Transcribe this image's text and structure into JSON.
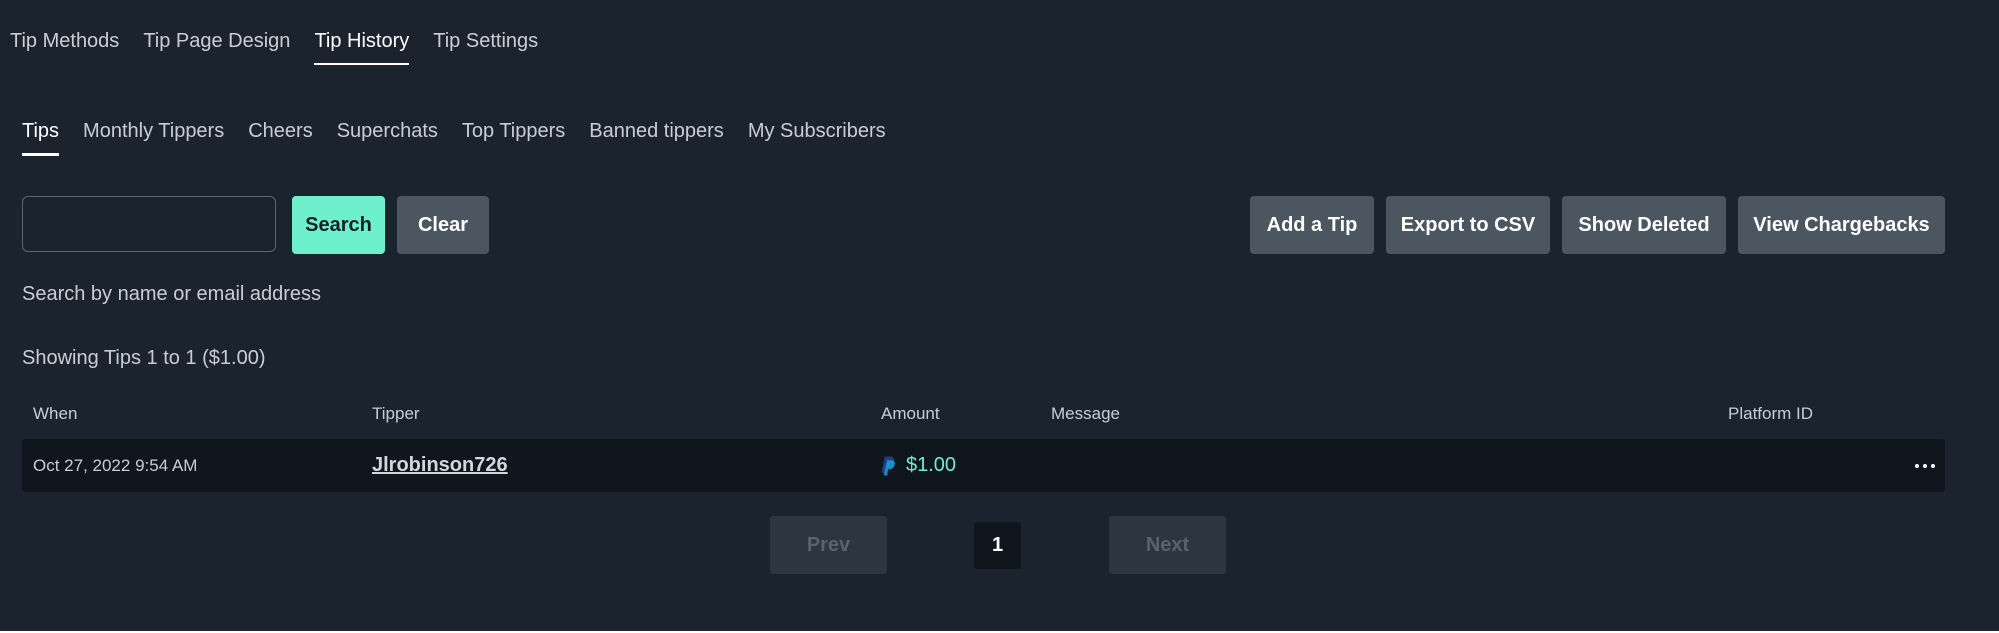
{
  "top_tabs": [
    {
      "label": "Tip Methods"
    },
    {
      "label": "Tip Page Design"
    },
    {
      "label": "Tip History",
      "active": true
    },
    {
      "label": "Tip Settings"
    }
  ],
  "sub_tabs": [
    {
      "label": "Tips",
      "active": true
    },
    {
      "label": "Monthly Tippers"
    },
    {
      "label": "Cheers"
    },
    {
      "label": "Superchats"
    },
    {
      "label": "Top Tippers"
    },
    {
      "label": "Banned tippers"
    },
    {
      "label": "My Subscribers"
    }
  ],
  "toolbar": {
    "search_value": "",
    "search_label": "Search",
    "clear_label": "Clear",
    "add_label": "Add a Tip",
    "export_label": "Export to CSV",
    "deleted_label": "Show Deleted",
    "chargebacks_label": "View Chargebacks"
  },
  "hint": "Search by name or email address",
  "showing": "Showing Tips 1 to 1 ($1.00)",
  "table": {
    "headers": {
      "when": "When",
      "tipper": "Tipper",
      "amount": "Amount",
      "message": "Message",
      "platform_id": "Platform ID"
    },
    "rows": [
      {
        "when": "Oct 27, 2022 9:54 AM",
        "tipper": "Jlrobinson726",
        "amount": "$1.00",
        "method_icon": "paypal-icon",
        "message": "",
        "platform_id": ""
      }
    ]
  },
  "pagination": {
    "prev_label": "Prev",
    "current_page": "1",
    "next_label": "Next"
  },
  "colors": {
    "background": "#1a232e",
    "accent": "#6ff0cc",
    "button_grey": "#4b5660",
    "row_background": "#0f161d",
    "paypal_dark": "#253b80",
    "paypal_light": "#179bd7"
  }
}
